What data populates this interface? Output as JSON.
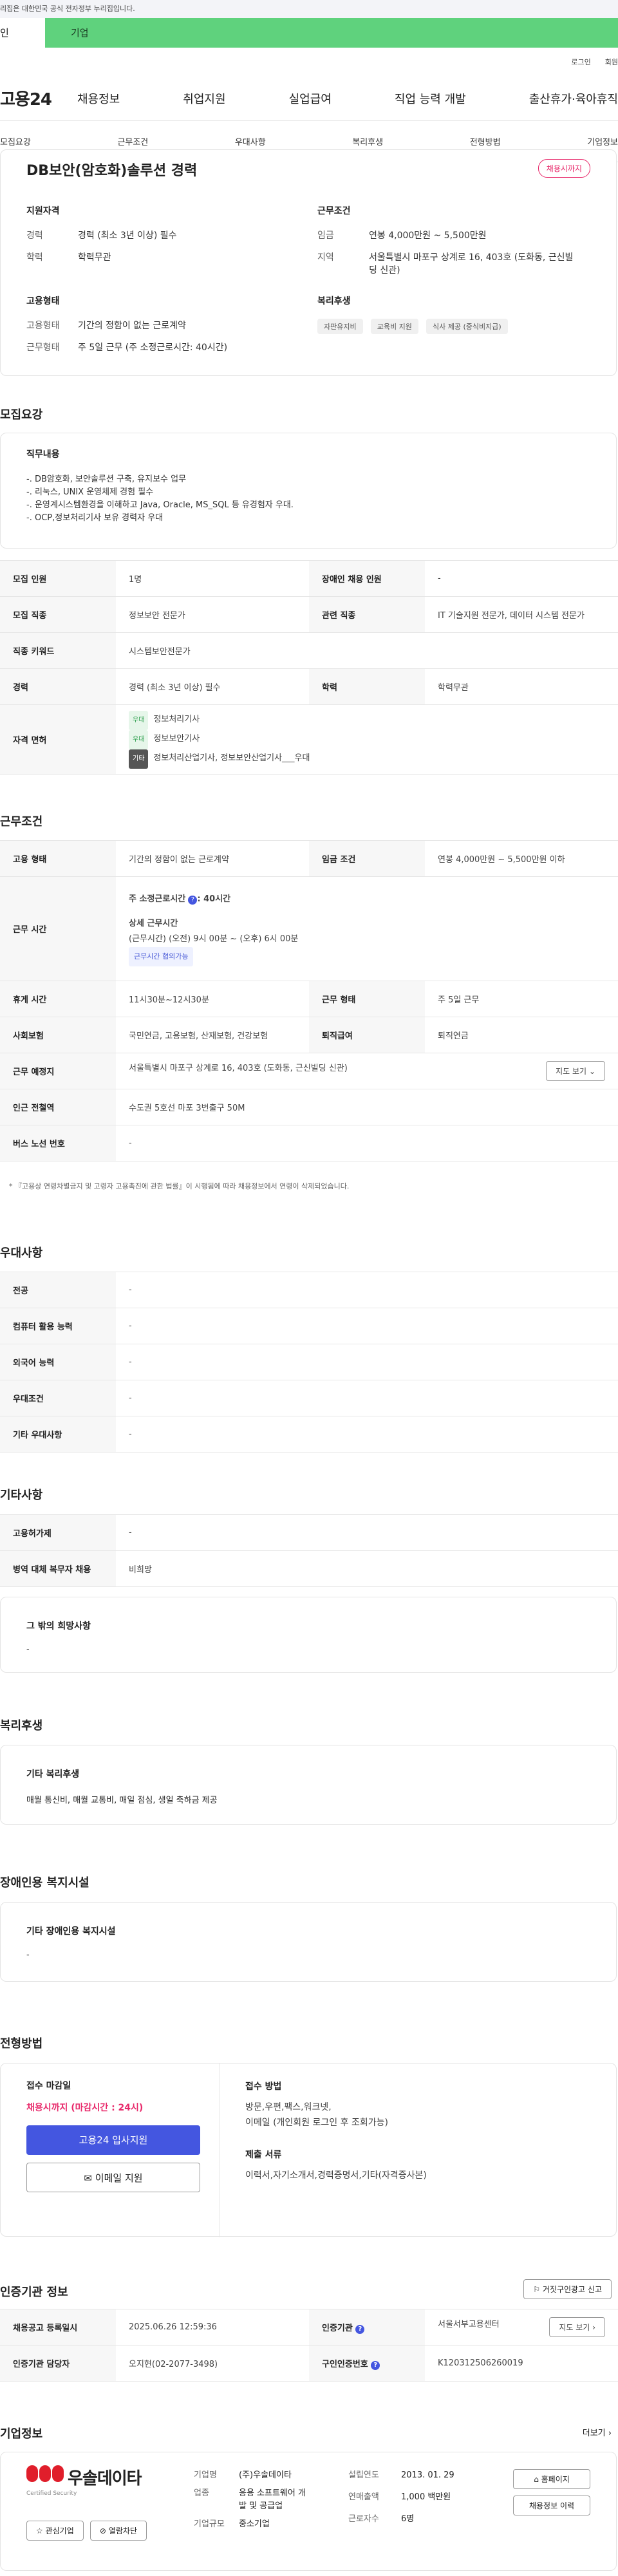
{
  "gov_notice": "이 누리집은 대한민국 공식 전자정부 누리집입니다.",
  "gov_notice_visible": "리집은 대한민국 공식 전자정부 누리집입니다.",
  "top_tabs": {
    "individual": "인",
    "business": "기업"
  },
  "util": {
    "login": "로그인",
    "signup": "회원"
  },
  "logo": "고용24",
  "gnb": [
    "채용정보",
    "취업지원",
    "실업급여",
    "직업 능력 개발",
    "출산휴가·육아휴직"
  ],
  "subnav": [
    "모집요강",
    "근무조건",
    "우대사항",
    "복리후생",
    "전형방법",
    "기업정보"
  ],
  "summary": {
    "title": "DB보안(암호화)솔루션 경력",
    "badge": "채용시까지",
    "qual_title": "지원자격",
    "qual": [
      {
        "k": "경력",
        "v": "경력 (최소 3년 이상) 필수"
      },
      {
        "k": "학력",
        "v": "학력무관"
      }
    ],
    "cond_title": "근무조건",
    "cond": [
      {
        "k": "임금",
        "v": "연봉 4,000만원 ~ 5,500만원"
      },
      {
        "k": "지역",
        "v": "서울특별시 마포구 상계로 16, 403호 (도화동, 근신빌딩 신관)"
      }
    ],
    "emp_title": "고용형태",
    "emp": [
      {
        "k": "고용형태",
        "v": "기간의 정함이 없는 근로계약"
      },
      {
        "k": "근무형태",
        "v": "주 5일 근무 (주 소정근로시간: 40시간)"
      }
    ],
    "welfare_title": "복리후생",
    "welfare_chips": [
      "자판유지비",
      "교육비 지원",
      "식사 제공 (중식비지급)"
    ]
  },
  "recruit": {
    "section_title": "모집요강",
    "duty_title": "직무내용",
    "duty_lines": [
      "-. DB암호화, 보안솔루션 구축, 유지보수 업무",
      "-. 리눅스, UNIX 운영체제 경험 필수",
      "-. 운영계시스템환경을 이해하고 Java, Oracle, MS_SQL 등 유경험자 우대.",
      "-. OCP,정보처리기사 보유 경력자 우대"
    ],
    "rows": [
      {
        "h1": "모집 인원",
        "v1": "1명",
        "h2": "장애인 채용 인원",
        "v2": "-"
      },
      {
        "h1": "모집 직종",
        "v1": "정보보안 전문가",
        "h2": "관련 직종",
        "v2": "IT 기술지원 전문가, 데이터 시스템 전문가"
      },
      {
        "h1": "직종 키워드",
        "v1": "시스템보안전문가"
      },
      {
        "h1": "경력",
        "v1": "경력 (최소 3년 이상) 필수",
        "h2": "학력",
        "v2": "학력무관"
      }
    ],
    "license_header": "자격 면허",
    "licenses": [
      {
        "tag": "우대",
        "name": "정보처리기사"
      },
      {
        "tag": "우대",
        "name": "정보보안기사"
      },
      {
        "tag": "기타",
        "name": "정보처리산업기사, 정보보안산업기사___우대"
      }
    ]
  },
  "work": {
    "section_title": "근무조건",
    "emp_type_h": "고용 형태",
    "emp_type": "기간의 정함이 없는 근로계약",
    "wage_h": "임금 조건",
    "wage": "연봉 4,000만원 ~ 5,500만원 이하",
    "hours_h": "근무 시간",
    "weekly_label": "주 소정근로시간",
    "weekly_value": ": 40시간",
    "detail_label": "상세 근무시간",
    "detail_value": "(근무시간) (오전) 9시 00분 ~ (오후) 6시 00분",
    "hours_pill": "근무시간 협의가능",
    "rest_h": "휴게 시간",
    "rest": "11시30분~12시30분",
    "shift_h": "근무 형태",
    "shift": "주 5일 근무",
    "ins_h": "사회보험",
    "ins": "국민연금, 고용보험, 산재보험, 건강보험",
    "retire_h": "퇴직급여",
    "retire": "퇴직연금",
    "place_h": "근무 예정지",
    "place": "서울특별시 마포구 상계로 16, 403호 (도화동, 근신빌딩 신관)",
    "map_btn": "지도 보기",
    "station_h": "인근 전철역",
    "station": "수도권 5호선 마포 3번출구 50M",
    "bus_h": "버스 노선 번호",
    "bus": "-",
    "note": "* 『고용상 연령차별금지 및 고령자 고용촉진에 관한 법률』이 시행됨에 따라 채용정보에서 연령이 삭제되었습니다."
  },
  "prefer": {
    "section_title": "우대사항",
    "rows": [
      {
        "h": "전공",
        "v": "-"
      },
      {
        "h": "컴퓨터 활용 능력",
        "v": "-"
      },
      {
        "h": "외국어 능력",
        "v": "-"
      },
      {
        "h": "우대조건",
        "v": "-"
      },
      {
        "h": "기타 우대사항",
        "v": "-"
      }
    ]
  },
  "etc": {
    "section_title": "기타사항",
    "rows": [
      {
        "h": "고용허가제",
        "v": "-"
      },
      {
        "h": "병역 대체 복무자 채용",
        "v": "비희망"
      }
    ],
    "box_title": "그 밖의 희망사항",
    "box_value": "-"
  },
  "benefit": {
    "section_title": "복리후생",
    "box_title": "기타 복리후생",
    "box_value": "매월 통신비, 매월 교통비, 매일 점심, 생일 축하금 제공"
  },
  "disabled": {
    "section_title": "장애인용 복지시설",
    "box_title": "기타 장애인용 복지시설",
    "box_value": "-"
  },
  "selection": {
    "section_title": "전형방법",
    "deadline_title": "접수 마감일",
    "deadline": "채용시까지 (마감시간 : 24시)",
    "apply_btn": "고용24 입사지원",
    "email_btn": "이메일 지원",
    "method_title": "접수 방법",
    "method": "방문,우편,팩스,워크넷,",
    "method2": "이메일 (개인회원 로그인 후 조회가능)",
    "docs_title": "제출 서류",
    "docs": "이력서,자기소개서,경력증명서,기타(자격증사본)"
  },
  "certify": {
    "section_title": "인증기관 정보",
    "report_btn": "거짓구인광고 신고",
    "reg_h": "채용공고 등록일시",
    "reg": "2025.06.26 12:59:36",
    "org_h": "인증기관",
    "org": "서울서부고용센터",
    "map_btn": "지도 보기",
    "manager_h": "인증기관 담당자",
    "manager": "오지현(02-2077-3498)",
    "number_h": "구인인증번호",
    "number": "K120312506260019"
  },
  "company": {
    "section_title": "기업정보",
    "more": "더보기",
    "logo_text": "우솔데이타",
    "logo_sub": "Certified Security",
    "interest_btn": "관심기업",
    "block_btn": "열람차단",
    "name_h": "기업명",
    "name": "(주)우솔데이타",
    "biz_h": "업종",
    "biz": "응용 소프트웨어 개발 및 공급업",
    "size_h": "기업규모",
    "size": "중소기업",
    "founded_h": "설립연도",
    "founded": "2013. 01. 29",
    "revenue_h": "연매출액",
    "revenue": "1,000 백만원",
    "workers_h": "근로자수",
    "workers": "6명",
    "homepage_btn": "홈페이지",
    "jobs_btn": "채용정보 이력"
  },
  "colors": {
    "brand_green": "#5fd27d",
    "badge_pink": "#e8286a",
    "primary_blue": "#4456e0",
    "deadline_red": "#e8286a"
  }
}
